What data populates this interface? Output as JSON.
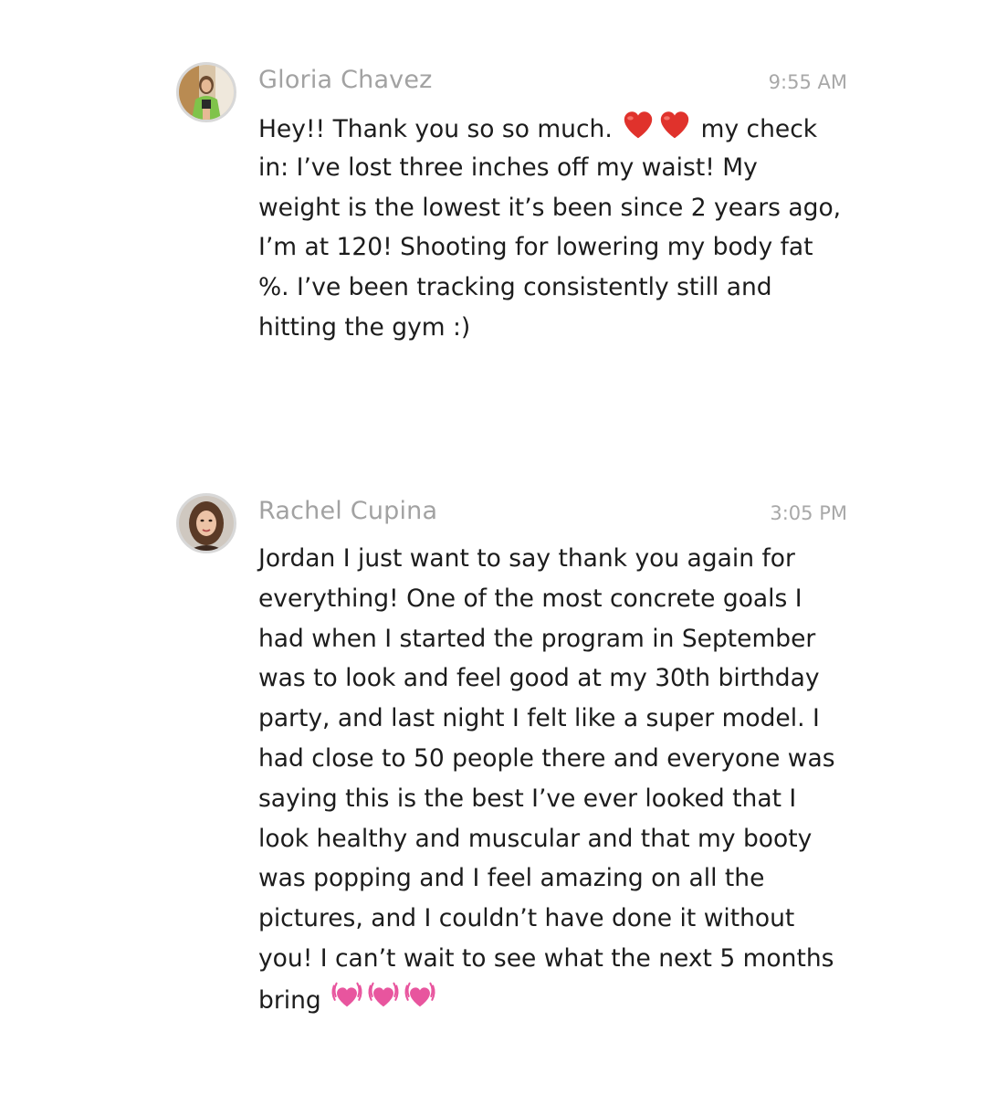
{
  "messages": [
    {
      "sender": "Gloria Chavez",
      "time": "9:55 AM",
      "lines": [
        {
          "before": "Hey!! Thank you so so much. ",
          "emojis": [
            "red-heart",
            "red-heart"
          ],
          "after": " my check"
        },
        {
          "before": "in: I’ve lost three inches off my waist! My"
        },
        {
          "before": "weight is the lowest it’s been since 2 years ago,"
        },
        {
          "before": "I’m at 120! Shooting for lowering my body fat"
        },
        {
          "before": "%. I’ve been tracking consistently still and"
        },
        {
          "before": "hitting the gym :)"
        }
      ]
    },
    {
      "sender": "Rachel Cupina",
      "time": "3:05 PM",
      "lines": [
        {
          "before": "Jordan I just want to say thank you again for"
        },
        {
          "before": "everything! One of the most concrete goals I"
        },
        {
          "before": "had when I started the program in September"
        },
        {
          "before": "was to look and feel good at my 30th birthday"
        },
        {
          "before": "party, and last night I felt like a super model. I"
        },
        {
          "before": "had close to 50 people there and everyone was"
        },
        {
          "before": "saying this is the best I’ve ever looked that I"
        },
        {
          "before": "look healthy and muscular and that my booty"
        },
        {
          "before": "was popping and I feel amazing on all the"
        },
        {
          "before": "pictures, and I couldn’t have done it without"
        },
        {
          "before": "you! I can’t wait to see what the next 5 months"
        },
        {
          "before": "bring ",
          "emojis": [
            "pink-beating-heart",
            "pink-beating-heart",
            "pink-beating-heart"
          ]
        }
      ]
    }
  ],
  "colors": {
    "sender": "#a2a2a2",
    "time": "#a8a8a8",
    "text": "#1c1c1c",
    "red_heart": "#e0322c",
    "pink_heart": "#e8559e"
  }
}
